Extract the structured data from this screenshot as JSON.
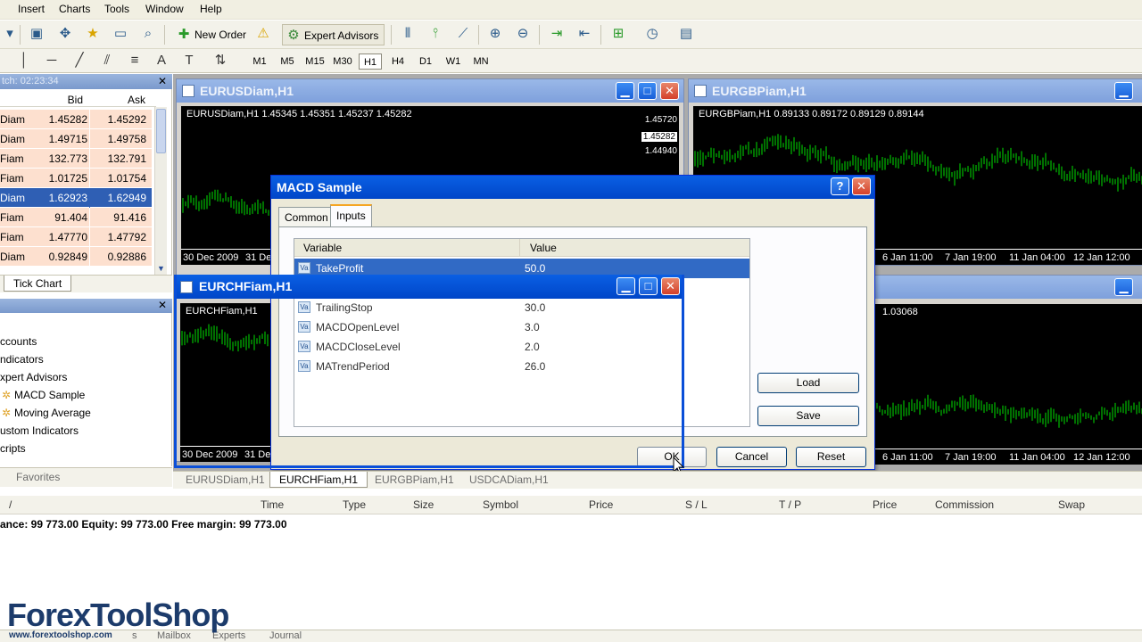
{
  "menu": [
    "Insert",
    "Charts",
    "Tools",
    "Window",
    "Help"
  ],
  "toolbar": {
    "new_order": "New Order",
    "expert_advisors": "Expert Advisors",
    "timeframes": [
      "M1",
      "M5",
      "M15",
      "M30",
      "H1",
      "H4",
      "D1",
      "W1",
      "MN"
    ],
    "selected_timeframe": "H1"
  },
  "market_watch": {
    "title": "tch: 02:23:34",
    "col_bid": "Bid",
    "col_ask": "Ask",
    "rows": [
      {
        "symbol": "Diam",
        "bid": "1.45282",
        "ask": "1.45292"
      },
      {
        "symbol": "Diam",
        "bid": "1.49715",
        "ask": "1.49758"
      },
      {
        "symbol": "Fiam",
        "bid": "132.773",
        "ask": "132.791"
      },
      {
        "symbol": "Fiam",
        "bid": "1.01725",
        "ask": "1.01754"
      },
      {
        "symbol": "Diam",
        "bid": "1.62923",
        "ask": "1.62949"
      },
      {
        "symbol": "Fiam",
        "bid": "91.404",
        "ask": "91.416"
      },
      {
        "symbol": "Fiam",
        "bid": "1.47770",
        "ask": "1.47792"
      },
      {
        "symbol": "Diam",
        "bid": "0.92849",
        "ask": "0.92886"
      }
    ],
    "selected_index": 4,
    "tab": "Tick Chart"
  },
  "navigator": {
    "items": [
      "ccounts",
      "ndicators",
      "xpert Advisors",
      "MACD Sample",
      "Moving Average",
      "ustom Indicators",
      "cripts"
    ],
    "tab": "Favorites"
  },
  "charts": {
    "eurusd": {
      "title": "EURUSDiam,H1",
      "info": "EURUSDiam,H1  1.45345 1.45351 1.45237 1.45282",
      "prices": [
        "1.45720",
        "1.45282",
        "1.44940"
      ],
      "dates": [
        "30 Dec 2009",
        "31 De"
      ]
    },
    "eurgbp": {
      "title": "EURGBPiam,H1",
      "info": "EURGBPiam,H1  0.89133 0.89172 0.89129 0.89144",
      "dates": [
        "6 Jan 11:00",
        "7 Jan 19:00",
        "11 Jan 04:00",
        "12 Jan 12:00"
      ]
    },
    "eurchf": {
      "title": "EURCHFiam,H1",
      "info": "EURCHFiam,H1",
      "dates": [
        "30 Dec 2009",
        "31 De"
      ]
    },
    "usdcad": {
      "info": "1.03068",
      "dates": [
        "6 Jan 11:00",
        "7 Jan 19:00",
        "11 Jan 04:00",
        "12 Jan 12:00"
      ]
    }
  },
  "dialog": {
    "title": "MACD Sample",
    "tabs": [
      "Common",
      "Inputs"
    ],
    "active_tab": "Inputs",
    "col_variable": "Variable",
    "col_value": "Value",
    "rows": [
      {
        "name": "TakeProfit",
        "value": "50.0"
      },
      {
        "name": "TrailingStop",
        "value": "30.0"
      },
      {
        "name": "MACDOpenLevel",
        "value": "3.0"
      },
      {
        "name": "MACDCloseLevel",
        "value": "2.0"
      },
      {
        "name": "MATrendPeriod",
        "value": "26.0"
      }
    ],
    "selected_row": 0,
    "load": "Load",
    "save": "Save",
    "ok": "OK",
    "cancel": "Cancel",
    "reset": "Reset"
  },
  "doc_tabs": [
    "EURUSDiam,H1",
    "EURCHFiam,H1",
    "EURGBPiam,H1",
    "USDCADiam,H1"
  ],
  "active_doc_tab": "EURCHFiam,H1",
  "terminal": {
    "columns": [
      "/",
      "Time",
      "Type",
      "Size",
      "Symbol",
      "Price",
      "S / L",
      "T / P",
      "Price",
      "Commission",
      "Swap"
    ],
    "balance_line": "ance: 99 773.00  Equity: 99 773.00  Free margin: 99 773.00"
  },
  "bottom_tabs": [
    "s",
    "Mailbox",
    "Experts",
    "Journal"
  ],
  "watermark": {
    "brand": "ForexToolShop",
    "url": "www.forextoolshop.com"
  }
}
